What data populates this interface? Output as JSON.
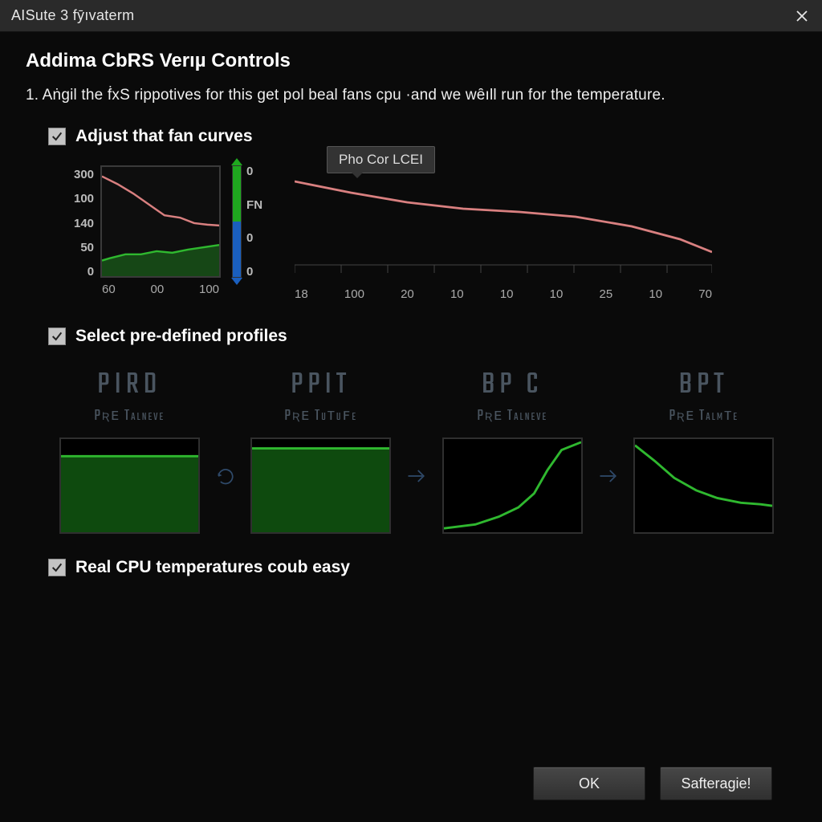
{
  "window": {
    "title": "AISute 3 fȳıvaterm"
  },
  "header": {
    "heading": "Addima CbRS Verıµ Controls",
    "instruction": "1. Aṅgil the ḟxS rippotives for this get pol beal fans cpu ·and we wȇıll run for the temperature."
  },
  "section_adjust": {
    "checkbox_label": "Adjust that fan curves",
    "checked": true,
    "mini_y": [
      "300",
      "100",
      "140",
      "50",
      "0"
    ],
    "mini_x": [
      "60",
      "00",
      "100"
    ],
    "right_scale": [
      "0",
      "FN",
      "0",
      "0"
    ],
    "tooltip": "Pho Cor LCEI",
    "big_x": [
      "18",
      "100",
      "20",
      "10",
      "10",
      "10",
      "25",
      "10",
      "70"
    ]
  },
  "section_profiles": {
    "checkbox_label": "Select pre-defined profiles",
    "checked": true,
    "items": [
      {
        "title": "PIRD",
        "sub": "Pʀᴇ Talneve"
      },
      {
        "title": "PPIT",
        "sub": "Pʀᴇ Tuᴛuꜰe"
      },
      {
        "title": "BP C",
        "sub": "Pʀᴇ Talneve"
      },
      {
        "title": "BPT",
        "sub": "Pʀᴇ Talmᴛe"
      }
    ]
  },
  "section_realtime": {
    "checkbox_label": "Real CPU temperatures coub easy",
    "checked": true
  },
  "footer": {
    "ok": "OK",
    "cancel": "Safteragie!"
  },
  "chart_data": [
    {
      "type": "line",
      "title": "mini fan curve",
      "x": [
        0,
        20,
        40,
        60,
        80,
        100,
        120,
        140
      ],
      "series": [
        {
          "name": "temp",
          "color": "#d98080",
          "values": [
            280,
            260,
            230,
            200,
            170,
            170,
            150,
            145
          ]
        },
        {
          "name": "fan",
          "color": "#2fb82f",
          "values": [
            40,
            45,
            55,
            55,
            65,
            62,
            70,
            75
          ]
        }
      ],
      "fill_between": {
        "series": "fan",
        "baseline": 0,
        "color": "#164716"
      },
      "ylim": [
        0,
        300
      ],
      "xlim": [
        0,
        140
      ],
      "yticks": [
        300,
        100,
        140,
        50,
        0
      ],
      "xticks": [
        60,
        0,
        100
      ]
    },
    {
      "type": "line",
      "title": "Pho Cor LCEI",
      "x": [
        18,
        100,
        20,
        10,
        10,
        10,
        25,
        10,
        70
      ],
      "series": [
        {
          "name": "curve",
          "color": "#d98080",
          "values": [
            92,
            86,
            80,
            76,
            74,
            72,
            68,
            62,
            50
          ]
        }
      ],
      "ylim": [
        0,
        100
      ]
    },
    {
      "type": "line",
      "title": "PIRD profile",
      "x": [
        0,
        25,
        50,
        75,
        100
      ],
      "series": [
        {
          "name": "fan",
          "color": "#2fb82f",
          "values": [
            80,
            80,
            80,
            80,
            80
          ]
        }
      ],
      "fill_between": {
        "series": "fan",
        "baseline": 0,
        "color": "#0e4a0e"
      },
      "ylim": [
        0,
        100
      ]
    },
    {
      "type": "line",
      "title": "PPIT profile",
      "x": [
        0,
        25,
        50,
        75,
        100
      ],
      "series": [
        {
          "name": "fan",
          "color": "#2fb82f",
          "values": [
            88,
            88,
            88,
            88,
            88
          ]
        }
      ],
      "fill_between": {
        "series": "fan",
        "baseline": 0,
        "color": "#0e4a0e"
      },
      "ylim": [
        0,
        100
      ]
    },
    {
      "type": "line",
      "title": "BPC profile",
      "x": [
        0,
        20,
        40,
        55,
        70,
        80,
        90,
        100
      ],
      "series": [
        {
          "name": "fan",
          "color": "#2fb82f",
          "values": [
            5,
            8,
            14,
            22,
            38,
            62,
            90,
            98
          ]
        }
      ],
      "ylim": [
        0,
        100
      ]
    },
    {
      "type": "line",
      "title": "BPT profile",
      "x": [
        0,
        15,
        30,
        45,
        60,
        75,
        90,
        100
      ],
      "series": [
        {
          "name": "fan",
          "color": "#2fb82f",
          "values": [
            95,
            80,
            62,
            50,
            44,
            40,
            38,
            36
          ]
        }
      ],
      "ylim": [
        0,
        100
      ]
    }
  ]
}
